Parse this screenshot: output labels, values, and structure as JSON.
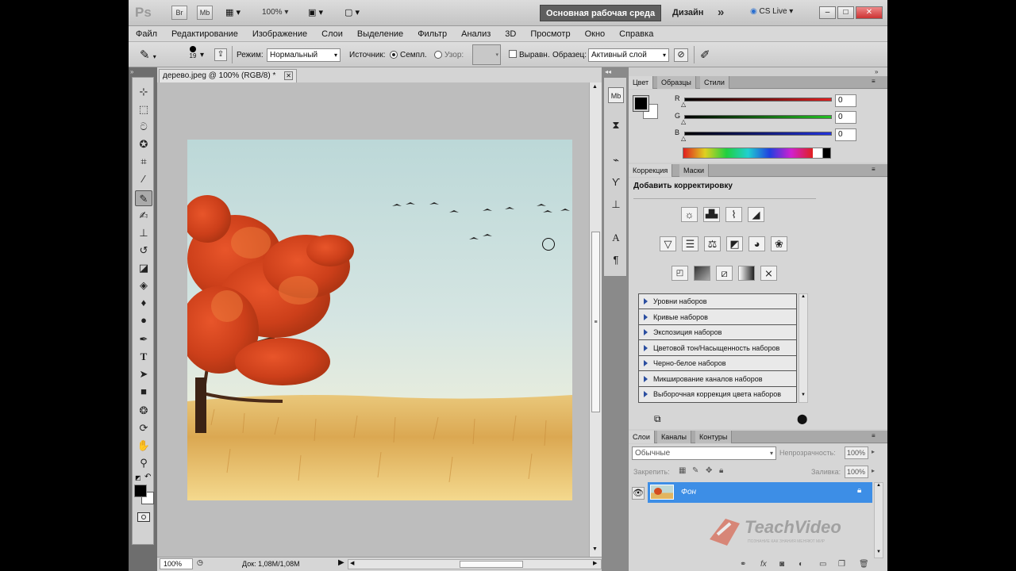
{
  "app": {
    "logo": "Ps"
  },
  "titlebar": {
    "items": [
      "Br",
      "Mb",
      "100%"
    ],
    "workspace_active": "Основная рабочая среда",
    "workspace_other": "Дизайн",
    "more": "»",
    "cs_live": "CS Live"
  },
  "menu": [
    "Файл",
    "Редактирование",
    "Изображение",
    "Слои",
    "Выделение",
    "Фильтр",
    "Анализ",
    "3D",
    "Просмотр",
    "Окно",
    "Справка"
  ],
  "options": {
    "brush_size": "19",
    "mode_label": "Режим:",
    "mode_value": "Нормальный",
    "source_label": "Источник:",
    "source_sampled": "Семпл.",
    "source_pattern": "Узор:",
    "aligned": "Выравн.",
    "sample_label": "Образец:",
    "sample_value": "Активный слой"
  },
  "document": {
    "tab_title": "дерево.jpeg @ 100% (RGB/8) *",
    "zoom": "100%",
    "doc_info": "Док: 1,08M/1,08M"
  },
  "color_panel": {
    "tabs": [
      "Цвет",
      "Образцы",
      "Стили"
    ],
    "channels": [
      {
        "label": "R",
        "value": "0",
        "color": "#d92020"
      },
      {
        "label": "G",
        "value": "0",
        "color": "#22b022"
      },
      {
        "label": "B",
        "value": "0",
        "color": "#2233cc"
      }
    ]
  },
  "adjustments_panel": {
    "tabs": [
      "Коррекция",
      "Маски"
    ],
    "heading": "Добавить корректировку",
    "presets": [
      "Уровни наборов",
      "Кривые наборов",
      "Экспозиция наборов",
      "Цветовой тон/Насыщенность наборов",
      "Черно-белое наборов",
      "Микширование каналов наборов",
      "Выборочная коррекция цвета наборов"
    ]
  },
  "layers_panel": {
    "tabs": [
      "Слои",
      "Каналы",
      "Контуры"
    ],
    "blend_mode": "Обычные",
    "opacity_label": "Непрозрачность:",
    "opacity_value": "100%",
    "lock_label": "Закрепить:",
    "fill_label": "Заливка:",
    "fill_value": "100%",
    "layers": [
      {
        "name": "Фон",
        "selected": true
      }
    ]
  },
  "watermark": {
    "brand": "TeachVideo",
    "tagline": "ПОЗНАНИЕ КАК ЗНАНИЯ МЕНЯЮТ МИР"
  }
}
